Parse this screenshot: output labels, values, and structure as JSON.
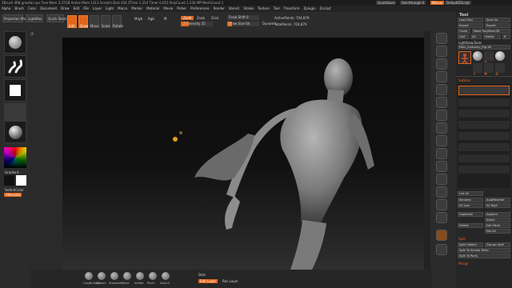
{
  "title_bar": {
    "text": "ZBrush 4R8    growfan.zpr    Free Mem 3.37GB  Active Mem 1313  Scratch Disk 456  ZTime 1.254  Timer 0.021  PolyCount 1.234 MP  MeshCount 1",
    "quicksave": "QuickSave",
    "see_through": "See-through 0",
    "menus": "Menus",
    "default_zscript": "DefaultZScript"
  },
  "menu_bar": {
    "items": [
      "Alpha",
      "Brush",
      "Color",
      "Document",
      "Draw",
      "Edit",
      "File",
      "Layer",
      "Light",
      "Macro",
      "Marker",
      "Material",
      "Movie",
      "Picker",
      "Preferences",
      "Render",
      "Stencil",
      "Stroke",
      "Texture",
      "Tool",
      "Transform",
      "Zplugin",
      "Zscript"
    ]
  },
  "shelf": {
    "projection_master": "Projection Master",
    "lightbox": "LightBox",
    "quick_sketch": "Quick Sketch",
    "edit": "Edit",
    "draw": "Draw",
    "move": "Move",
    "scale": "Scale",
    "rotate": "Rotate",
    "mrgb": "Mrgb",
    "rgb": "Rgb",
    "m": "M",
    "zadd": "Zadd",
    "zsub": "Zsub",
    "zcut": "Zcut",
    "z_intensity": "Z Intensity 25",
    "focal_shift": "Focal Shift 0",
    "draw_size": "Draw Size 64",
    "dynamic": "Dynamic",
    "active_points": "ActivePoints: 704,879",
    "total_points": "TotalPoints: 704,879"
  },
  "coords": "0.971,-0.113,0.405",
  "left_tray": {
    "gradient": "Gradient",
    "switch_color": "SwitchColor",
    "alternate": "Alternate"
  },
  "tool_panel": {
    "title": "Tool",
    "load_tool": "Load Tool",
    "save_as": "Save As",
    "import": "Import",
    "export": "Export",
    "clone": "Clone",
    "make_polymesh": "Make PolyMesh3D",
    "goz": "GoZ",
    "all": "All",
    "visible": "Visible",
    "r": "R",
    "lightbox_tools": "Lightbox▸Tools",
    "current_tool": "Male_Anatomy_Rig 48",
    "subtool": "Subtool",
    "list_all": "List All",
    "rename": "Rename",
    "autoreorder": "AutoReorder",
    "all_low": "All Low",
    "all_high": "All High",
    "duplicate": "Duplicate",
    "append": "Append",
    "insert": "Insert",
    "delete": "Delete",
    "del_other": "Del Other",
    "del_all": "Del All",
    "split": "Split",
    "split_hidden": "Split Hidden",
    "groups_split": "Groups Split",
    "split_to_similar": "Split To Similar Parts",
    "split_to_parts": "Split To Parts",
    "merge": "Merge"
  },
  "bottom_bar": {
    "brushes": [
      "ClayBuildup",
      "hPolish",
      "Standard",
      "Move",
      "Inflate",
      "Pinch",
      "Slash3"
    ],
    "dots": "Dots",
    "lazy_mouse": "LazyMouse",
    "edit_layer": "Edit Layer",
    "rec_layer": "Rec Layer"
  },
  "colors": {
    "accent": "#e2651a",
    "panel": "#262626",
    "canvas_top": "#0a0a0a",
    "model": "#8a8a8a"
  },
  "icons": [
    "brush-icon",
    "stroke-icon",
    "alpha-icon",
    "texture-icon",
    "material-icon",
    "color-picker-icon",
    "scroll-icon",
    "zoom-icon",
    "actual-icon",
    "persp-icon",
    "floor-icon",
    "local-icon",
    "frame-icon",
    "move-icon",
    "scale-icon",
    "rotate-icon",
    "transp-icon",
    "solo-icon"
  ]
}
